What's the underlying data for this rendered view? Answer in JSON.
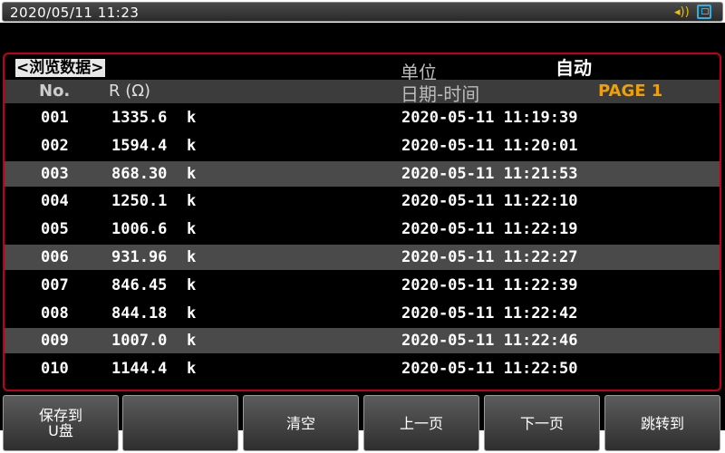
{
  "status_bar": {
    "datetime": "2020/05/11  11:23",
    "icons": [
      "signal-icon",
      "usb-disk-icon"
    ]
  },
  "panel": {
    "title": "<浏览数据>",
    "unit_label": "单位",
    "unit_value": "自动",
    "headers": {
      "no": "No.",
      "r": "R (Ω)",
      "datetime": "日期-时间",
      "page": "PAGE 1"
    },
    "rows": [
      {
        "no": "001",
        "value": "1335.6",
        "unit": "k",
        "datetime": "2020-05-11  11:19:39"
      },
      {
        "no": "002",
        "value": "1594.4",
        "unit": "k",
        "datetime": "2020-05-11  11:20:01"
      },
      {
        "no": "003",
        "value": "868.30",
        "unit": "k",
        "datetime": "2020-05-11  11:21:53"
      },
      {
        "no": "004",
        "value": "1250.1",
        "unit": "k",
        "datetime": "2020-05-11  11:22:10"
      },
      {
        "no": "005",
        "value": "1006.6",
        "unit": "k",
        "datetime": "2020-05-11  11:22:19"
      },
      {
        "no": "006",
        "value": "931.96",
        "unit": "k",
        "datetime": "2020-05-11  11:22:27"
      },
      {
        "no": "007",
        "value": "846.45",
        "unit": "k",
        "datetime": "2020-05-11  11:22:39"
      },
      {
        "no": "008",
        "value": "844.18",
        "unit": "k",
        "datetime": "2020-05-11  11:22:42"
      },
      {
        "no": "009",
        "value": "1007.0",
        "unit": "k",
        "datetime": "2020-05-11  11:22:46"
      },
      {
        "no": "010",
        "value": "1144.4",
        "unit": "k",
        "datetime": "2020-05-11  11:22:50"
      }
    ]
  },
  "softkeys": [
    {
      "label": "保存到\nU盘",
      "name": "save-to-usb-button"
    },
    {
      "label": "",
      "name": "blank-softkey"
    },
    {
      "label": "清空",
      "name": "clear-button"
    },
    {
      "label": "上一页",
      "name": "prev-page-button"
    },
    {
      "label": "下一页",
      "name": "next-page-button"
    },
    {
      "label": "跳转到",
      "name": "goto-button"
    }
  ]
}
